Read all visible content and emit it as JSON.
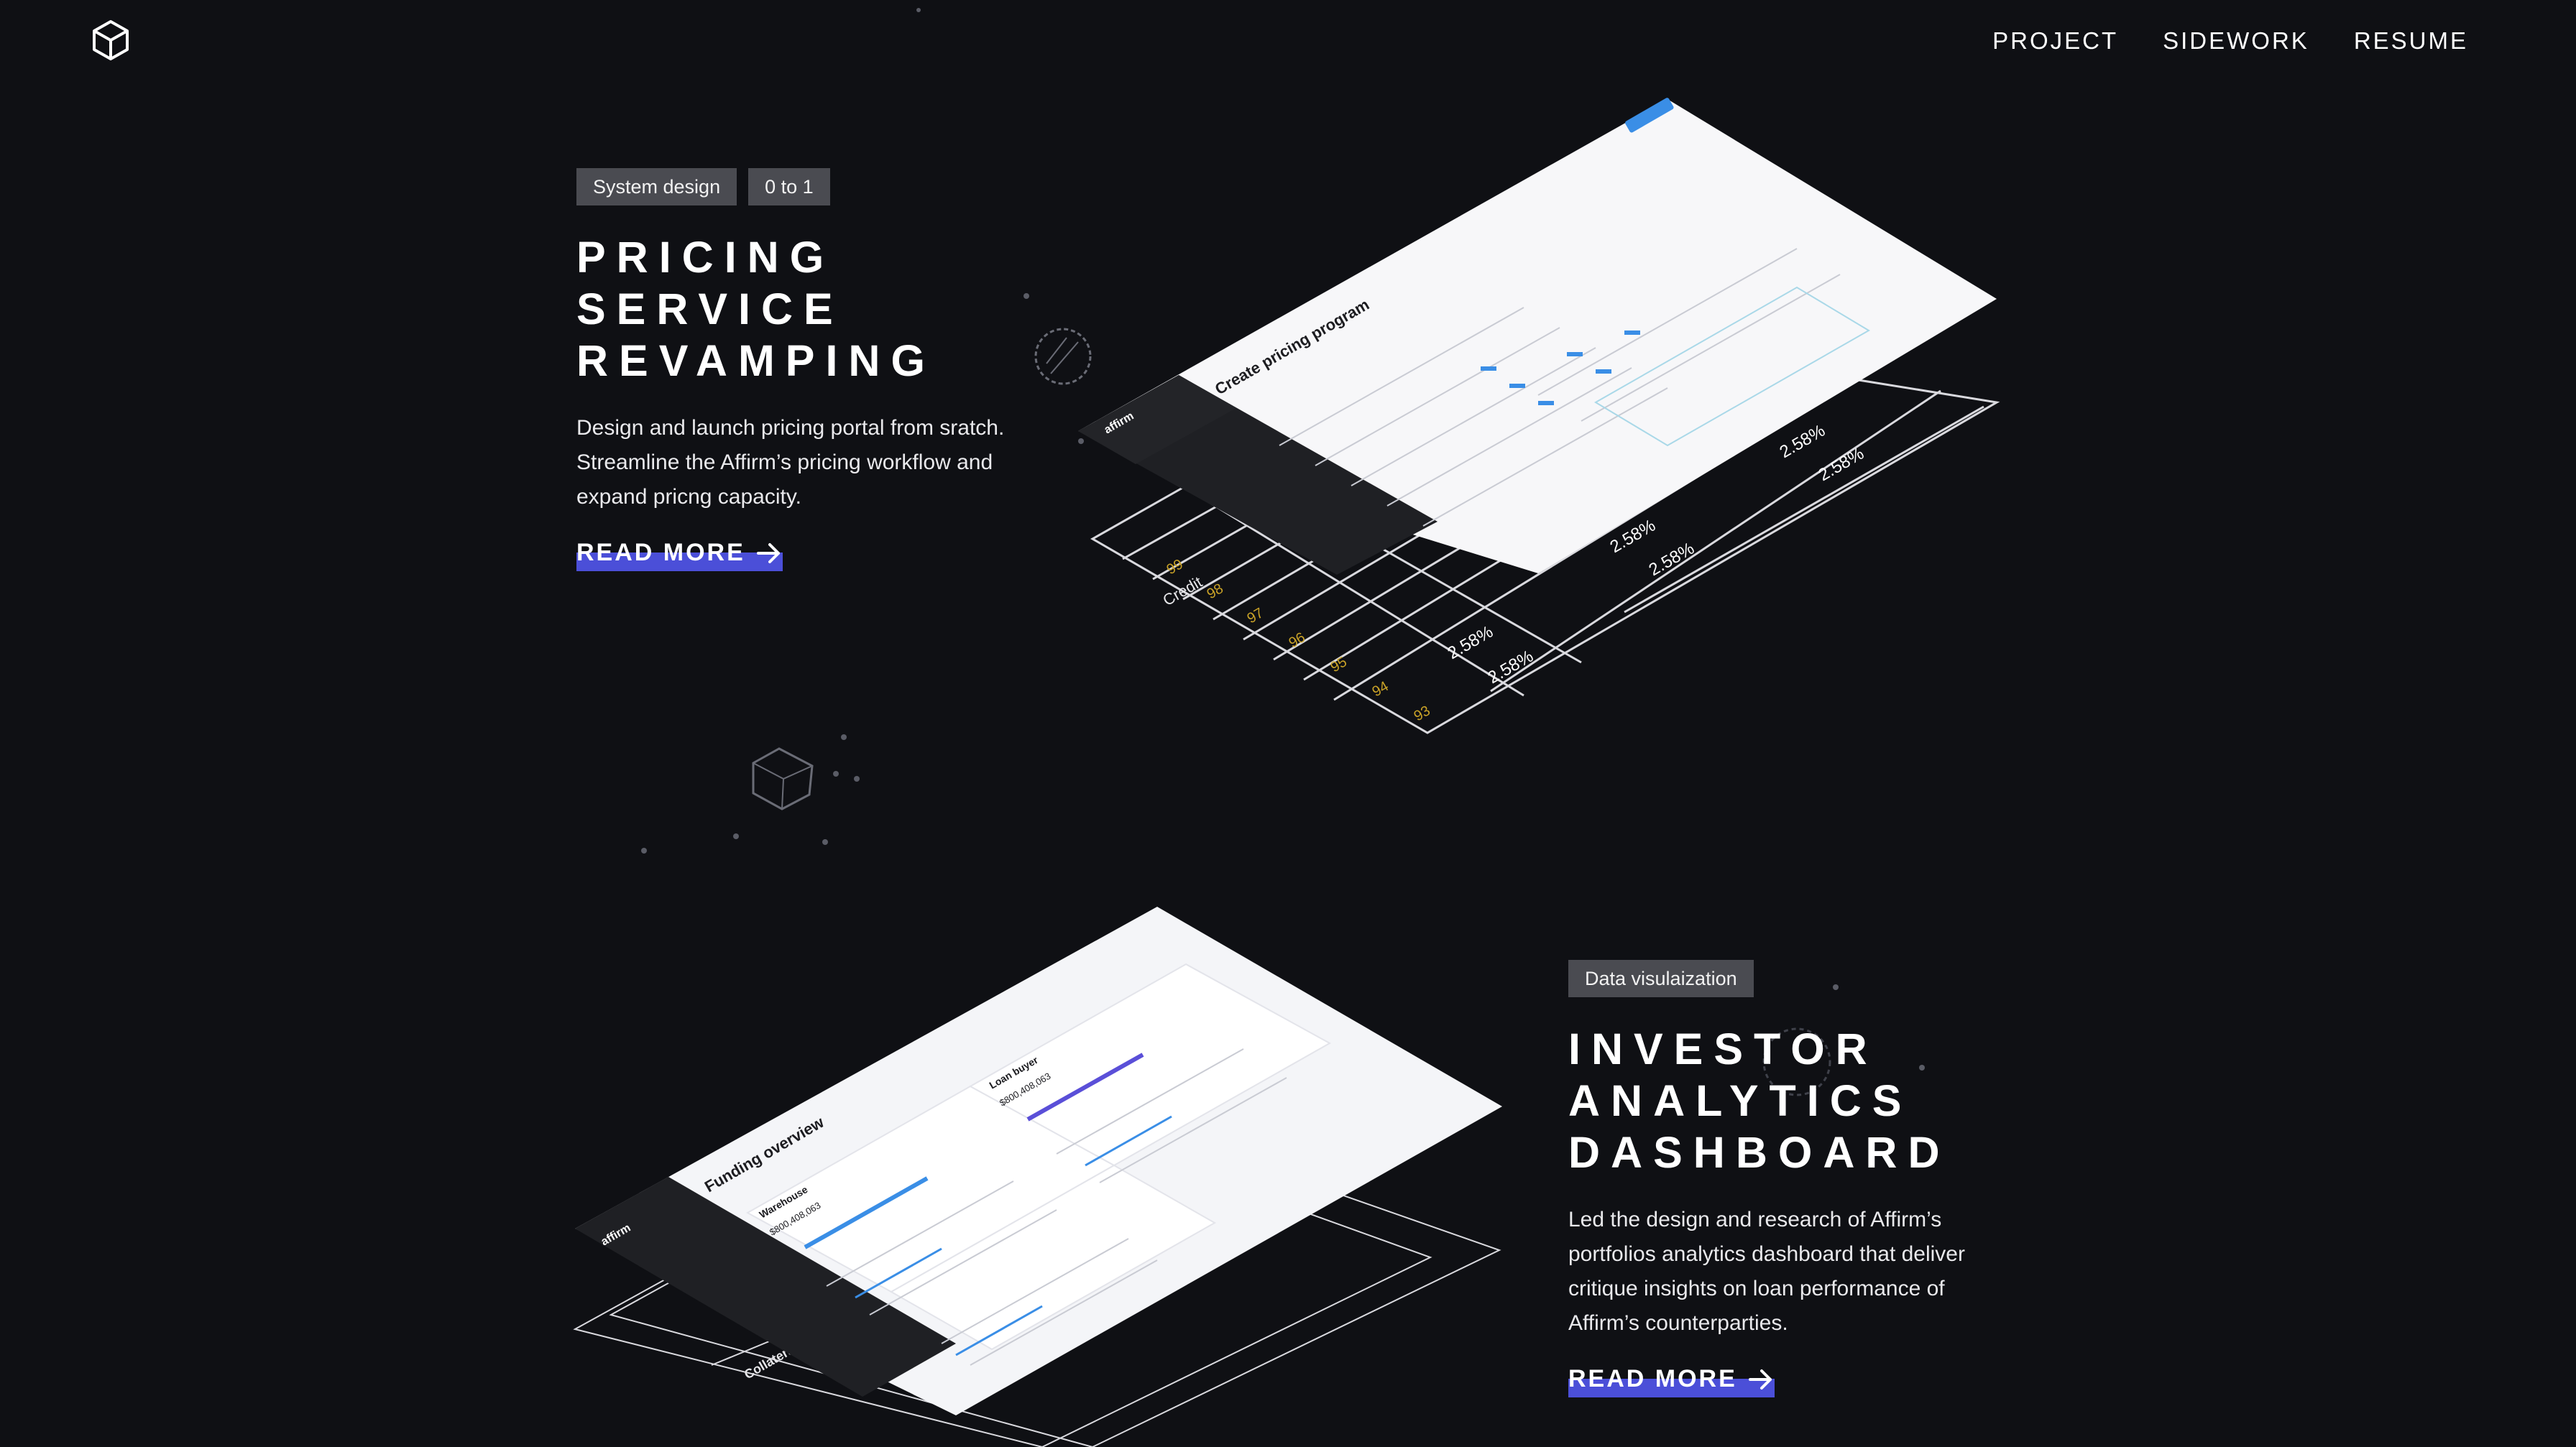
{
  "nav": {
    "logo_icon": "cube-icon",
    "items": [
      "PROJECT",
      "SIDEWORK",
      "RESUME"
    ]
  },
  "projects": [
    {
      "tags": [
        "System design",
        "0 to 1"
      ],
      "title_lines": [
        "PRICING",
        "SERVICE",
        "REVAMPING"
      ],
      "description_lines": [
        "Design and launch pricing portal from sratch.",
        "Streamline the Affirm’s pricing workflow and",
        "expand pricng capacity."
      ],
      "read_more": "READ MORE",
      "mockup": {
        "app_title": "Create pricing program",
        "brand": "affirm",
        "grid_label": "Credit",
        "grid_scores": [
          "99",
          "98",
          "97",
          "96",
          "95",
          "94",
          "93"
        ],
        "grid_rate": "2.58%"
      }
    },
    {
      "tags": [
        "Data visulaization"
      ],
      "title_lines": [
        "INVESTOR",
        "ANALYTICS",
        "DASHBOARD"
      ],
      "description_lines": [
        "Led the design and research of Affirm’s",
        "portfolios analytics dashboard that deliver",
        "critique insights on loan performance of",
        "Affirm’s counterparties."
      ],
      "read_more": "READ MORE",
      "mockup": {
        "app_title": "Funding overview",
        "brand": "affirm",
        "card_labels": [
          "Warehouse",
          "Loan buyer"
        ],
        "card_values": [
          "$800,408,063",
          "$800,408,063"
        ],
        "layer_label": "Collateral"
      }
    }
  ],
  "colors": {
    "background": "#0f1014",
    "accent": "#4b4fd8",
    "tag_bg": "#4a4b51",
    "score_yellow": "#c9a227"
  }
}
